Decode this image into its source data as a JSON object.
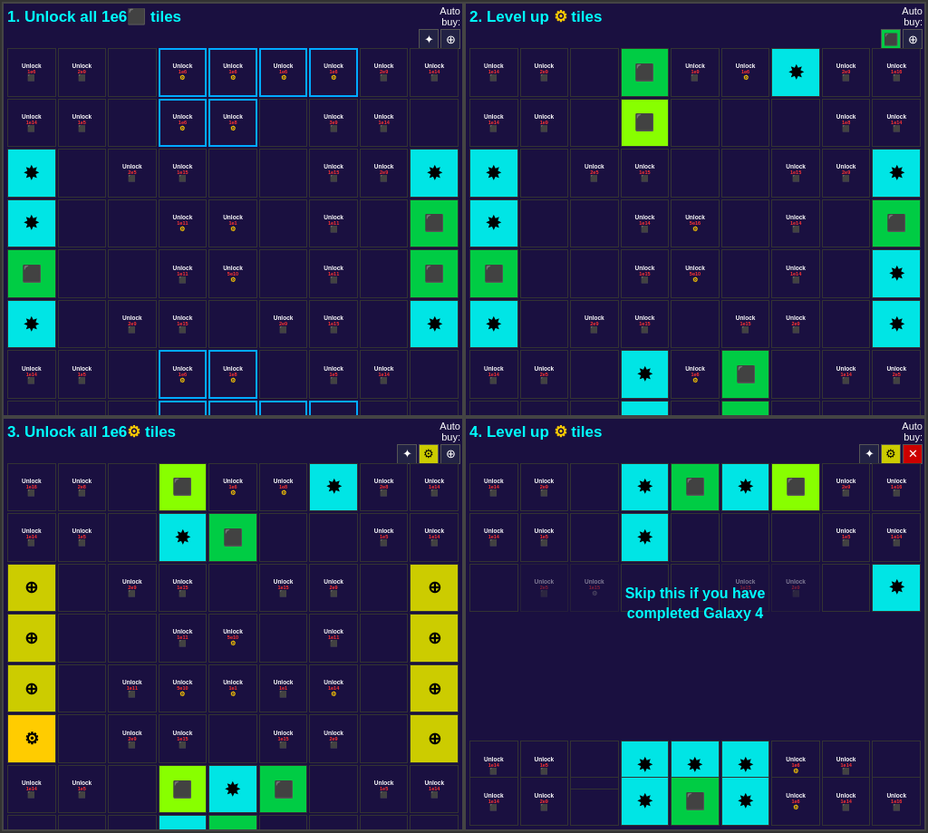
{
  "quadrants": [
    {
      "id": "q1",
      "title": "1. Unlock all 1e6",
      "titleIcon": "cube",
      "titleText": " tiles",
      "autoBuy": {
        "label": "Auto buy:",
        "buttons": [
          "★",
          "✦",
          "⊕"
        ]
      },
      "autoBuyColors": [
        "dark",
        "dark",
        "dark"
      ]
    },
    {
      "id": "q2",
      "title": "2. Level up",
      "titleIcon": "gear",
      "titleText": " tiles",
      "autoBuy": {
        "label": "Auto buy:",
        "buttons": [
          "⬛",
          "★",
          "⊕"
        ]
      },
      "autoBuyColors": [
        "green",
        "dark",
        "dark"
      ]
    },
    {
      "id": "q3",
      "title": "3. Unlock all 1e6",
      "titleIcon": "gear",
      "titleText": " tiles",
      "autoBuy": {
        "label": "Auto buy:",
        "buttons": [
          "★",
          "⚙",
          "⊕"
        ]
      },
      "autoBuyColors": [
        "dark",
        "yellow",
        "dark"
      ]
    },
    {
      "id": "q4",
      "title": "4. Level up",
      "titleIcon": "gear",
      "titleText": " tiles",
      "autoBuy": {
        "label": "Auto buy:",
        "buttons": [
          "★",
          "⚙",
          "✕"
        ]
      },
      "autoBuyColors": [
        "dark",
        "yellow",
        "red"
      ],
      "skipText": "Skip this if you have completed Galaxy 4"
    }
  ],
  "icons": {
    "cube": "⬛",
    "gear": "⚙",
    "star": "✦",
    "starburst": "✸",
    "cross": "⊕"
  }
}
